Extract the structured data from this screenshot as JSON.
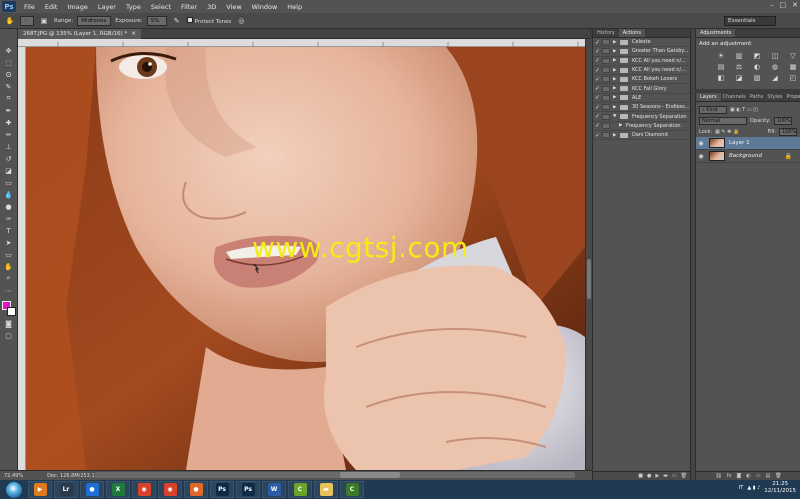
{
  "app": {
    "logo": "Ps"
  },
  "menu": [
    "File",
    "Edit",
    "Image",
    "Layer",
    "Type",
    "Select",
    "Filter",
    "3D",
    "View",
    "Window",
    "Help"
  ],
  "window_controls": [
    "–",
    "□",
    "✕"
  ],
  "options": {
    "range_label": "Range:",
    "range_value": "Midtones",
    "exposure_label": "Exposure:",
    "exposure_value": "5%",
    "protect_tones_label": "Protect Tones",
    "workspace": "Essentials"
  },
  "document": {
    "tab_title": "268T.JPG @ 135% (Layer 1, RGB/16) *",
    "watermark": "www.cgtsj.com"
  },
  "status": {
    "zoom": "72,49%",
    "doc": "Doc: 126,8M/253,1M"
  },
  "actions_panel": {
    "tabs": [
      "History",
      "Actions"
    ],
    "rows": [
      {
        "label": "Celeste",
        "expanded": false
      },
      {
        "label": "Greater Than Gatsby...",
        "expanded": false
      },
      {
        "label": "KCC All you need n/...",
        "expanded": false
      },
      {
        "label": "KCC All you need n/...",
        "expanded": false
      },
      {
        "label": "KCC Bokeh Lovers",
        "expanded": false
      },
      {
        "label": "KCC Fall Glory",
        "expanded": false
      },
      {
        "label": "ALE",
        "expanded": false
      },
      {
        "label": "30 Seasons - Endless...",
        "expanded": false
      },
      {
        "label": "Frequency Separation",
        "expanded": true
      },
      {
        "label": "Frequency Separation",
        "expanded": false,
        "child": true
      },
      {
        "label": "Dani Diamond",
        "expanded": false
      }
    ]
  },
  "adjustments": {
    "tab": "Adjustments",
    "title": "Add an adjustment",
    "icons": [
      "☀",
      "▥",
      "◩",
      "◫",
      "▽",
      "▤",
      "⚖",
      "◐",
      "◍",
      "▦",
      "◧",
      "◪",
      "▨",
      "◢",
      "◰"
    ]
  },
  "layers_panel": {
    "tabs": [
      "Layers",
      "Channels",
      "Paths",
      "Styles",
      "Properties"
    ],
    "kind_label": "Kind",
    "blend_mode": "Normal",
    "opacity_label": "Opacity:",
    "opacity_value": "100%",
    "lock_label": "Lock:",
    "fill_label": "Fill:",
    "fill_value": "100%",
    "layers": [
      {
        "name": "Layer 1",
        "selected": true
      },
      {
        "name": "Background",
        "selected": false,
        "locked": true
      }
    ],
    "footer_icons": [
      "⛓",
      "fx",
      "◙",
      "◐",
      "▭",
      "▤",
      "🗑"
    ]
  },
  "taskbar": {
    "apps": [
      {
        "name": "windows-media-icon",
        "glyph": "▶",
        "bg": "#e07a1a"
      },
      {
        "name": "lightroom-icon",
        "glyph": "Lr",
        "bg": "#2a3a4a"
      },
      {
        "name": "firefox-icon",
        "glyph": "●",
        "bg": "#1f6fd2"
      },
      {
        "name": "excel-icon",
        "glyph": "X",
        "bg": "#1e7b3a"
      },
      {
        "name": "chrome-icon",
        "glyph": "◉",
        "bg": "#d9412c"
      },
      {
        "name": "chrome-icon-2",
        "glyph": "◉",
        "bg": "#d9412c"
      },
      {
        "name": "firefox-icon-2",
        "glyph": "●",
        "bg": "#e0682a"
      },
      {
        "name": "photoshop-icon",
        "glyph": "Ps",
        "bg": "#0e2a45"
      },
      {
        "name": "photoshop-icon-2",
        "glyph": "Ps",
        "bg": "#0e2a45"
      },
      {
        "name": "word-icon",
        "glyph": "W",
        "bg": "#2b5ca6"
      },
      {
        "name": "camtasia-icon",
        "glyph": "C",
        "bg": "#6aa52a"
      },
      {
        "name": "folder-icon",
        "glyph": "▬",
        "bg": "#e5c25a"
      },
      {
        "name": "camtasia-icon-2",
        "glyph": "C",
        "bg": "#3c7a2a"
      }
    ],
    "lang": "IT",
    "time": "21:25",
    "date": "12/11/2015"
  }
}
